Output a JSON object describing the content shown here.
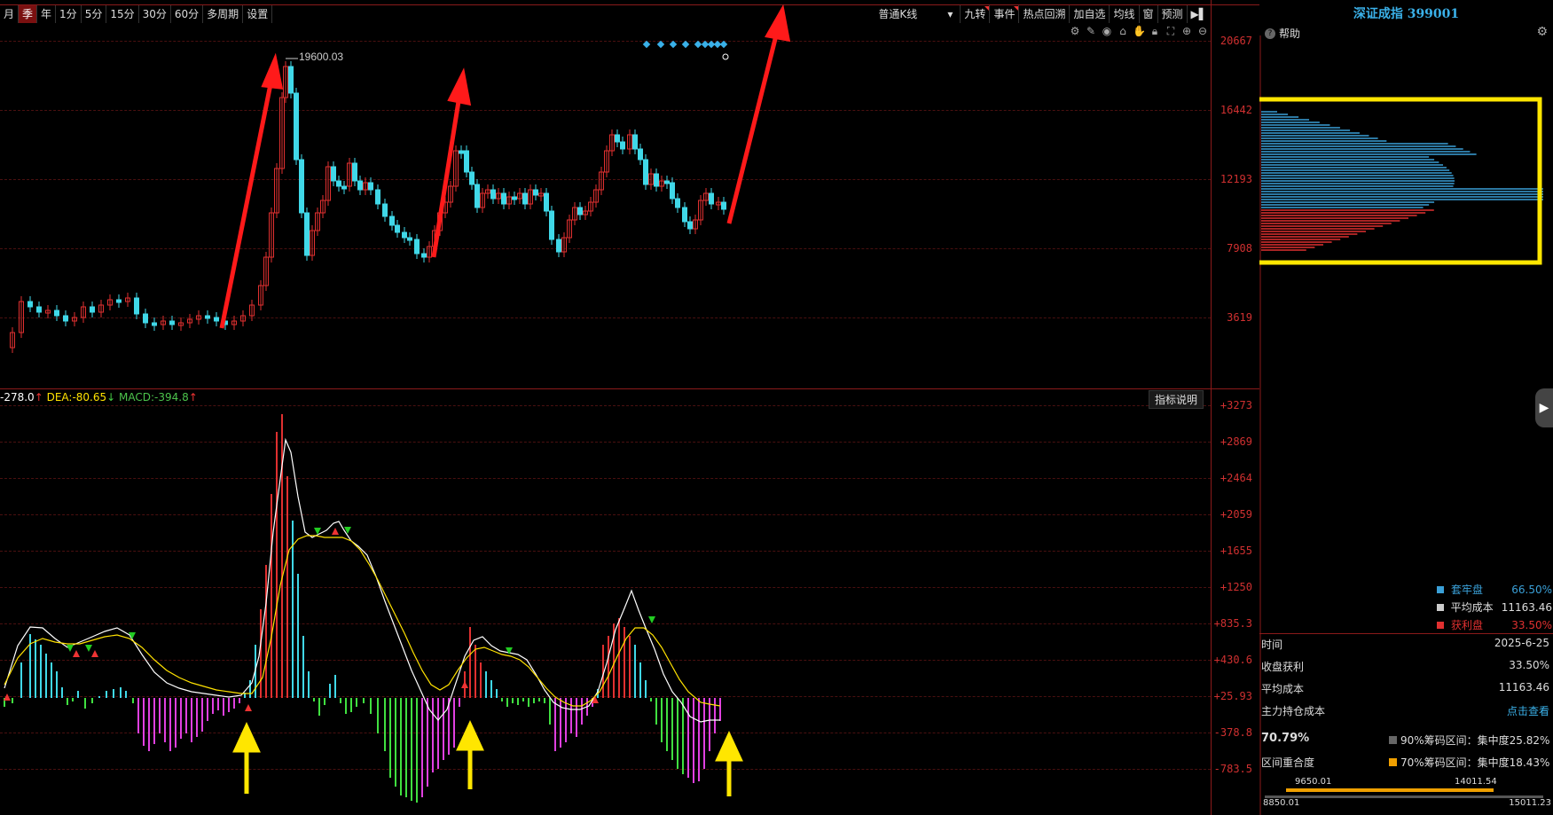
{
  "toolbar": {
    "periods": [
      "月",
      "季",
      "年",
      "1分",
      "5分",
      "15分",
      "30分",
      "60分",
      "多周期",
      "设置"
    ],
    "active_period": "季",
    "kline_type": "普通K线",
    "tools": [
      "九转",
      "事件",
      "热点回溯",
      "加自选",
      "均线",
      "窗",
      "预测"
    ]
  },
  "price_axis": [
    "20667",
    "16442",
    "12193",
    "7908",
    "3619"
  ],
  "peak_label": "19600.03",
  "macd_legend": {
    "dif": "-278.0",
    "dea_label": "DEA:",
    "dea": "-80.65",
    "macd_label": "MACD:",
    "macd": "-394.8"
  },
  "indicator_button": "指标说明",
  "macd_axis": [
    "+3273",
    "+2869",
    "+2464",
    "+2059",
    "+1655",
    "+1250",
    "+835.3",
    "+430.6",
    "+25.93",
    "-378.8",
    "-783.5"
  ],
  "right_panel": {
    "title": "深证成指 399001",
    "help": "帮助",
    "legend": [
      {
        "label": "套牢盘",
        "value": "66.50%",
        "color": "#3aa0d8"
      },
      {
        "label": "平均成本",
        "value": "11163.46",
        "color": "#cccccc"
      },
      {
        "label": "获利盘",
        "value": "33.50%",
        "color": "#e03030"
      }
    ],
    "info": {
      "time_label": "时间",
      "time": "2025-6-25",
      "profit_label": "收盘获利",
      "profit": "33.50%",
      "avg_label": "平均成本",
      "avg": "11163.46",
      "main_label": "主力持仓成本",
      "main_link": "点击查看",
      "overlap": "70.79%",
      "overlap_label": "区间重合度",
      "range90": "90%筹码区间：集中度25.82%",
      "range70": "70%筹码区间：集中度18.43%",
      "low70": "9650.01",
      "high70": "14011.54",
      "low90": "8850.01",
      "high90": "15011.23"
    }
  },
  "colors": {
    "up": "#e03030",
    "down": "#40d8e8",
    "accent_yellow": "#ffe600",
    "chip_blue": "#3aa0d8",
    "chip_red": "#e03030"
  }
}
